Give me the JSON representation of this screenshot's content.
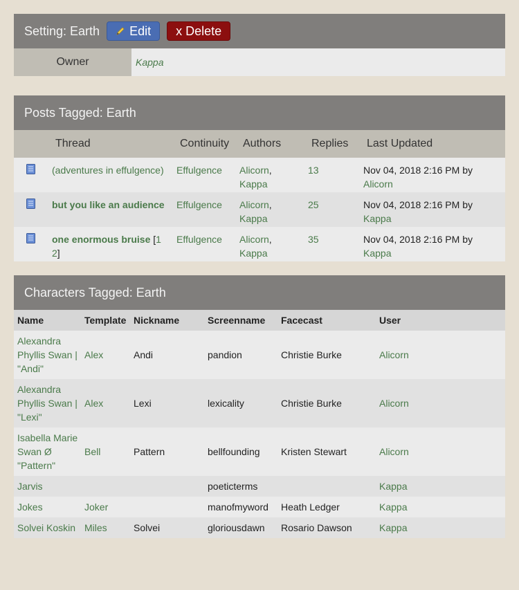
{
  "setting": {
    "title": "Setting: Earth",
    "edit_label": "Edit",
    "delete_label": "x Delete",
    "owner_label": "Owner",
    "owner_value": "Kappa"
  },
  "posts": {
    "title": "Posts Tagged: Earth",
    "headers": {
      "thread": "Thread",
      "continuity": "Continuity",
      "authors": "Authors",
      "replies": "Replies",
      "updated": "Last Updated"
    },
    "rows": [
      {
        "thread": "(adventures in effulgence)",
        "continuity": "Effulgence",
        "author1": "Alicorn",
        "author2": "Kappa",
        "replies": "13",
        "updated": "Nov 04, 2018 2:16 PM by",
        "updated_by": "Alicorn"
      },
      {
        "thread": "but you like an audience",
        "continuity": "Effulgence",
        "author1": "Alicorn",
        "author2": "Kappa",
        "replies": "25",
        "updated": "Nov 04, 2018 2:16 PM by",
        "updated_by": "Kappa"
      },
      {
        "thread": "one enormous bruise",
        "page1": "1",
        "page2": "2",
        "continuity": "Effulgence",
        "author1": "Alicorn",
        "author2": "Kappa",
        "replies": "35",
        "updated": "Nov 04, 2018 2:16 PM by",
        "updated_by": "Kappa"
      }
    ]
  },
  "characters": {
    "title": "Characters Tagged: Earth",
    "headers": {
      "name": "Name",
      "template": "Template",
      "nickname": "Nickname",
      "screenname": "Screenname",
      "facecast": "Facecast",
      "user": "User"
    },
    "rows": [
      {
        "name": "Alexandra Phyllis Swan | \"Andi\"",
        "template": "Alex",
        "nickname": "Andi",
        "screenname": "pandion",
        "facecast": "Christie Burke",
        "user": "Alicorn"
      },
      {
        "name": "Alexandra Phyllis Swan | \"Lexi\"",
        "template": "Alex",
        "nickname": "Lexi",
        "screenname": "lexicality",
        "facecast": "Christie Burke",
        "user": "Alicorn"
      },
      {
        "name": "Isabella Marie Swan Ø \"Pattern\"",
        "template": "Bell",
        "nickname": "Pattern",
        "screenname": "bellfounding",
        "facecast": "Kristen Stewart",
        "user": "Alicorn"
      },
      {
        "name": "Jarvis",
        "template": "",
        "nickname": "",
        "screenname": "poeticterms",
        "facecast": "",
        "user": "Kappa"
      },
      {
        "name": "Jokes",
        "template": "Joker",
        "nickname": "",
        "screenname": "manofmyword",
        "facecast": "Heath Ledger",
        "user": "Kappa"
      },
      {
        "name": "Solvei Koskin",
        "template": "Miles",
        "nickname": "Solvei",
        "screenname": "gloriousdawn",
        "facecast": "Rosario Dawson",
        "user": "Kappa"
      }
    ]
  }
}
